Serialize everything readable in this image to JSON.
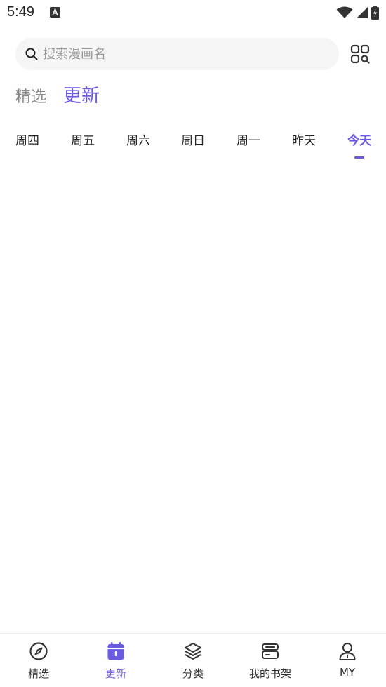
{
  "status_bar": {
    "time": "5:49"
  },
  "search": {
    "placeholder": "搜索漫画名",
    "value": ""
  },
  "top_tabs": [
    {
      "label": "精选",
      "active": false
    },
    {
      "label": "更新",
      "active": true
    }
  ],
  "day_tabs": [
    {
      "label": "周四",
      "active": false
    },
    {
      "label": "周五",
      "active": false
    },
    {
      "label": "周六",
      "active": false
    },
    {
      "label": "周日",
      "active": false
    },
    {
      "label": "周一",
      "active": false
    },
    {
      "label": "昨天",
      "active": false
    },
    {
      "label": "今天",
      "active": true
    }
  ],
  "bottom_nav": [
    {
      "label": "精选",
      "icon": "compass-icon",
      "active": false
    },
    {
      "label": "更新",
      "icon": "calendar-icon",
      "active": true
    },
    {
      "label": "分类",
      "icon": "layers-icon",
      "active": false
    },
    {
      "label": "我的书架",
      "icon": "bookshelf-icon",
      "active": false
    },
    {
      "label": "MY",
      "icon": "user-icon",
      "active": false
    }
  ],
  "colors": {
    "accent": "#6a5ae0",
    "text": "#222222",
    "muted": "#8a8a8a",
    "search_bg": "#f5f5f5"
  }
}
